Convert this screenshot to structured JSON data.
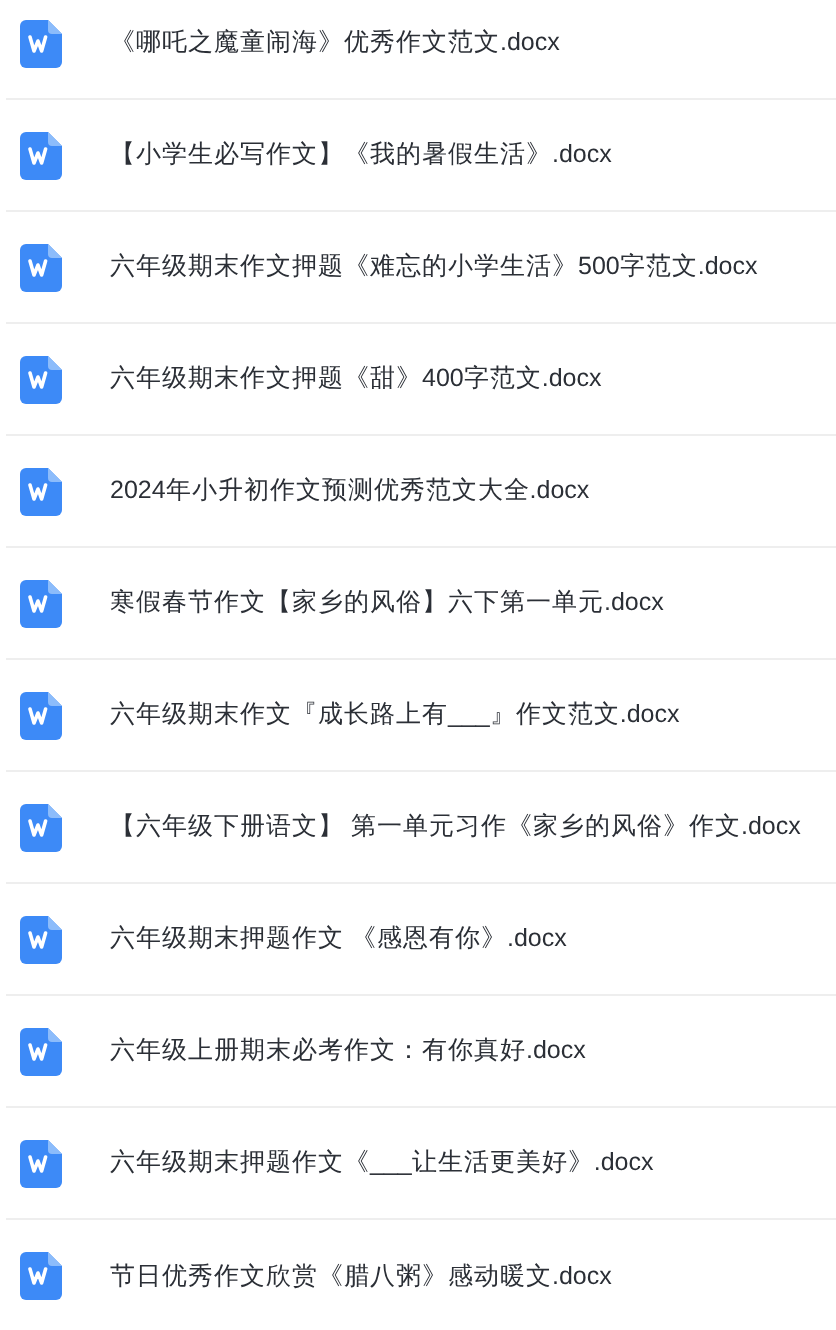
{
  "files": [
    {
      "name": "《哪吒之魔童闹海》优秀作文范文.docx"
    },
    {
      "name": "【小学生必写作文】《我的暑假生活》.docx"
    },
    {
      "name": "六年级期末作文押题《难忘的小学生活》500字范文.docx"
    },
    {
      "name": "六年级期末作文押题《甜》400字范文.docx"
    },
    {
      "name": "2024年小升初作文预测优秀范文大全.docx"
    },
    {
      "name": "寒假春节作文【家乡的风俗】六下第一单元.docx"
    },
    {
      "name": "六年级期末作文『成长路上有___』作文范文.docx"
    },
    {
      "name": "【六年级下册语文】 第一单元习作《家乡的风俗》作文.docx"
    },
    {
      "name": "六年级期末押题作文 《感恩有你》.docx"
    },
    {
      "name": "六年级上册期末必考作文：有你真好.docx"
    },
    {
      "name": "六年级期末押题作文《___让生活更美好》.docx"
    },
    {
      "name": "节日优秀作文欣赏《腊八粥》感动暖文.docx"
    }
  ]
}
